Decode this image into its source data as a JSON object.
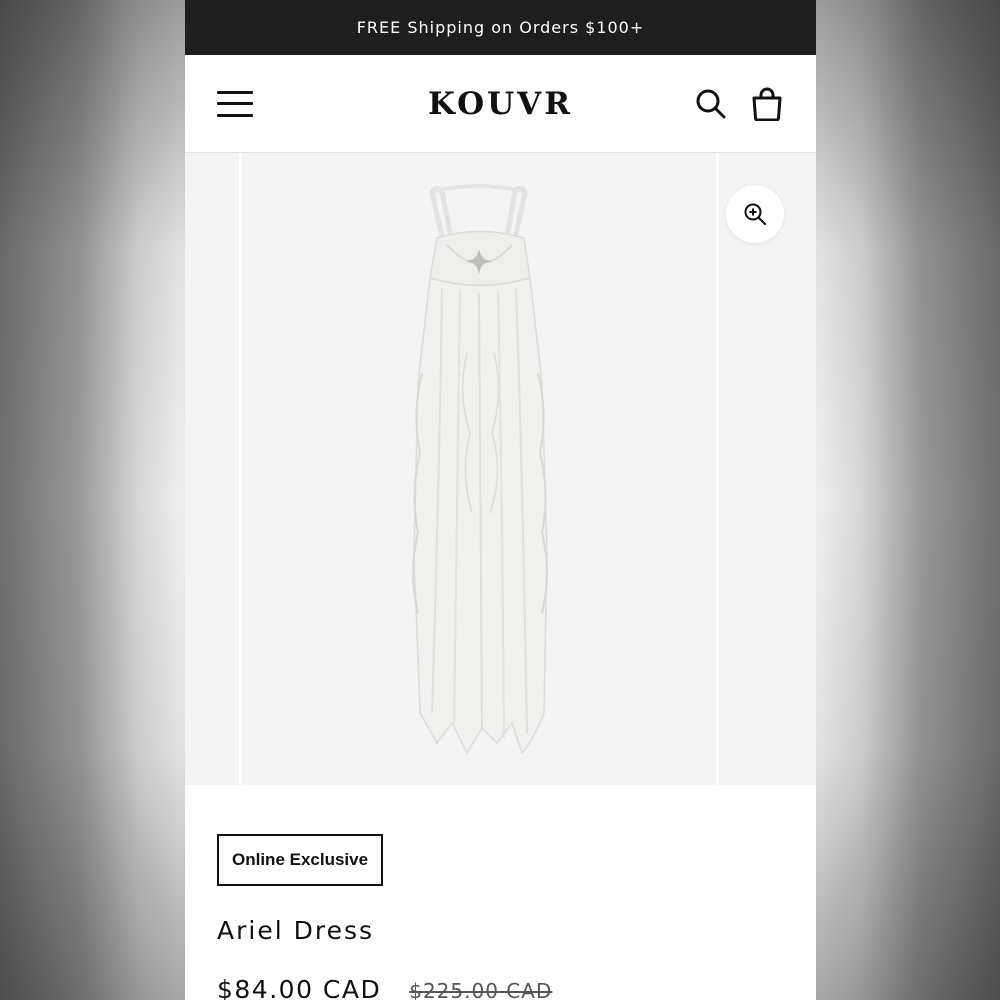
{
  "announcement": {
    "text": "FREE Shipping on Orders $100+"
  },
  "header": {
    "logo": "KOUVR",
    "icons": [
      "menu-icon",
      "search-icon",
      "bag-icon"
    ]
  },
  "gallery": {
    "zoom_icon": "zoom-in-icon",
    "image_description_icon": "dress-image"
  },
  "product": {
    "badge": "Online Exclusive",
    "title": "Ariel Dress",
    "price": "$84.00 CAD",
    "compare_price": "$225.00 CAD"
  },
  "colors": {
    "announcement_bg": "#1e1e1e",
    "text": "#111111",
    "gallery_bg": "#f4f4f4"
  }
}
